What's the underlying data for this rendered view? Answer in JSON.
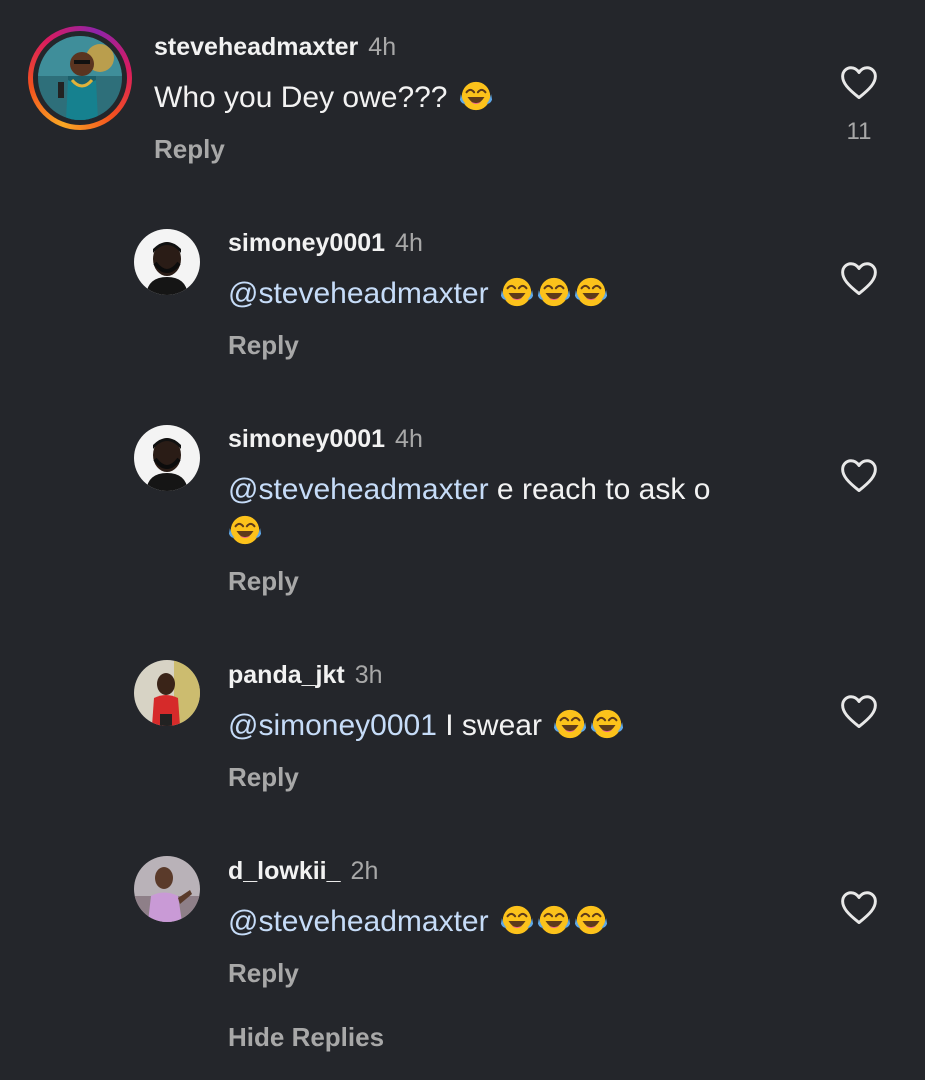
{
  "comments": [
    {
      "username": "steveheadmaxter",
      "time": "4h",
      "text": "Who you Dey owe???",
      "emojis": [
        "tears-of-joy"
      ],
      "reply_label": "Reply",
      "like_count": "11",
      "has_story_ring": true
    },
    {
      "username": "simoney0001",
      "time": "4h",
      "mention": "@steveheadmaxter",
      "text": "",
      "emojis": [
        "tears-of-joy",
        "tears-of-joy",
        "tears-of-joy"
      ],
      "reply_label": "Reply"
    },
    {
      "username": "simoney0001",
      "time": "4h",
      "mention": "@steveheadmaxter",
      "text": " e reach to ask o",
      "emojis": [
        "tears-of-joy"
      ],
      "reply_label": "Reply"
    },
    {
      "username": "panda_jkt",
      "time": "3h",
      "mention": "@simoney0001",
      "text": " I swear",
      "emojis": [
        "tears-of-joy",
        "tears-of-joy"
      ],
      "reply_label": "Reply"
    },
    {
      "username": "d_lowkii_",
      "time": "2h",
      "mention": "@steveheadmaxter",
      "text": "",
      "emojis": [
        "tears-of-joy",
        "tears-of-joy",
        "tears-of-joy"
      ],
      "reply_label": "Reply"
    }
  ],
  "hide_replies_label": "Hide Replies",
  "colors": {
    "background": "#24262b",
    "text": "#f2f2f2",
    "muted": "#a8a8a8",
    "mention": "#c6dcf8"
  },
  "icons": {
    "like": "heart-outline-icon",
    "emoji": "face-with-tears-of-joy-emoji"
  }
}
